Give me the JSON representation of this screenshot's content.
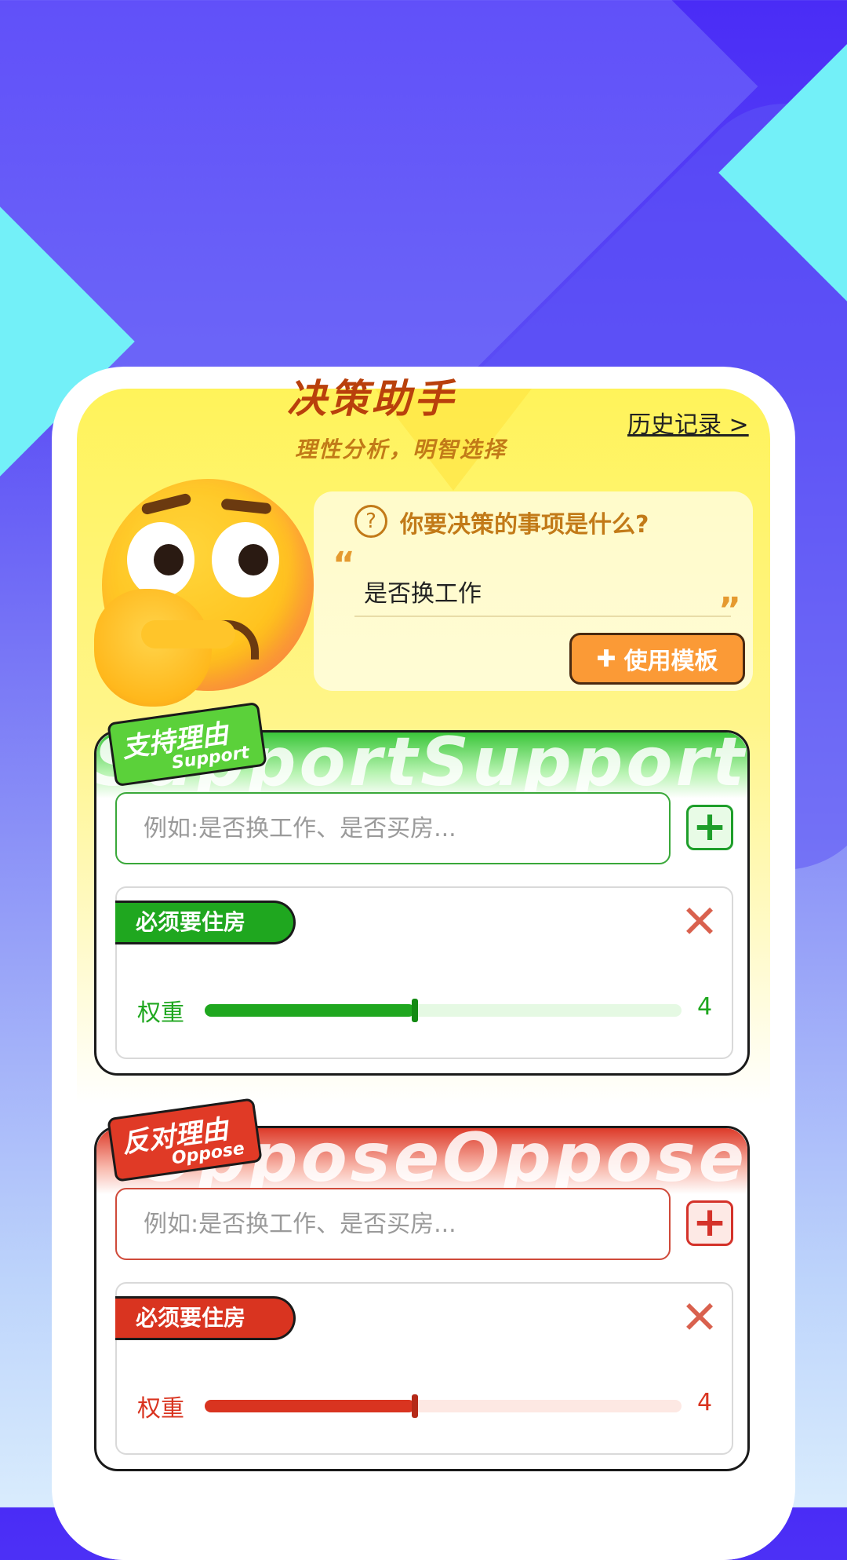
{
  "header": {
    "title": "决策助手",
    "subtitle": "理性分析，明智选择",
    "history_link": "历史记录 >"
  },
  "question": {
    "prompt": "你要决策的事项是什么?",
    "value": "是否换工作",
    "open_quote": "“",
    "close_quote": "”",
    "template_button": "使用模板"
  },
  "support": {
    "tag": "支持理由",
    "tag_en": "Support",
    "bg_word": "SupportSupport",
    "input_placeholder": "例如:是否换工作、是否买房...",
    "add_label": "+",
    "items": [
      {
        "label": "必须要住房",
        "weight_label": "权重",
        "weight": 4,
        "weight_fraction": 0.44
      }
    ],
    "color": "#1fa71f"
  },
  "oppose": {
    "tag": "反对理由",
    "tag_en": "Oppose",
    "bg_word": "OpposeOppose",
    "input_placeholder": "例如:是否换工作、是否买房...",
    "add_label": "+",
    "items": [
      {
        "label": "必须要住房",
        "weight_label": "权重",
        "weight": 4,
        "weight_fraction": 0.44
      }
    ],
    "color": "#d93420"
  },
  "icons": {
    "close": "✕",
    "question": "?",
    "puzzle": "✚"
  }
}
